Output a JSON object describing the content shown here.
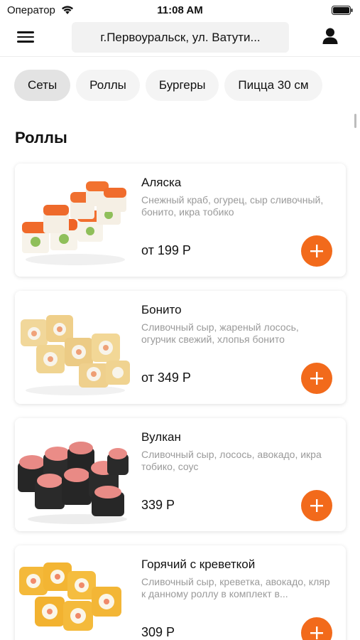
{
  "status_bar": {
    "carrier": "Оператор",
    "time": "11:08 AM"
  },
  "header": {
    "address": "г.Первоуральск, ул. Ватути..."
  },
  "categories": [
    {
      "label": "Сеты",
      "active": true
    },
    {
      "label": "Роллы",
      "active": false
    },
    {
      "label": "Бургеры",
      "active": false
    },
    {
      "label": "Пицца 30 см",
      "active": false
    }
  ],
  "section": {
    "title": "Роллы"
  },
  "products": [
    {
      "name": "Аляска",
      "description": "Снежный краб, огурец, сыр сливочный, бонито, икра тобико",
      "price": "от 199 Р"
    },
    {
      "name": "Бонито",
      "description": "Сливочный сыр, жареный лосось, огурчик свежий, хлопья бонито",
      "price": "от 349 Р"
    },
    {
      "name": "Вулкан",
      "description": "Сливочный сыр, лосось, авокадо, икра тобико, соус",
      "price": "339 Р"
    },
    {
      "name": "Горячий с креветкой",
      "description": "Сливочный сыр, креветка, авокадо, кляр к данному роллу в комплект в...",
      "price": "309 Р"
    }
  ],
  "colors": {
    "accent": "#f26a1b"
  }
}
